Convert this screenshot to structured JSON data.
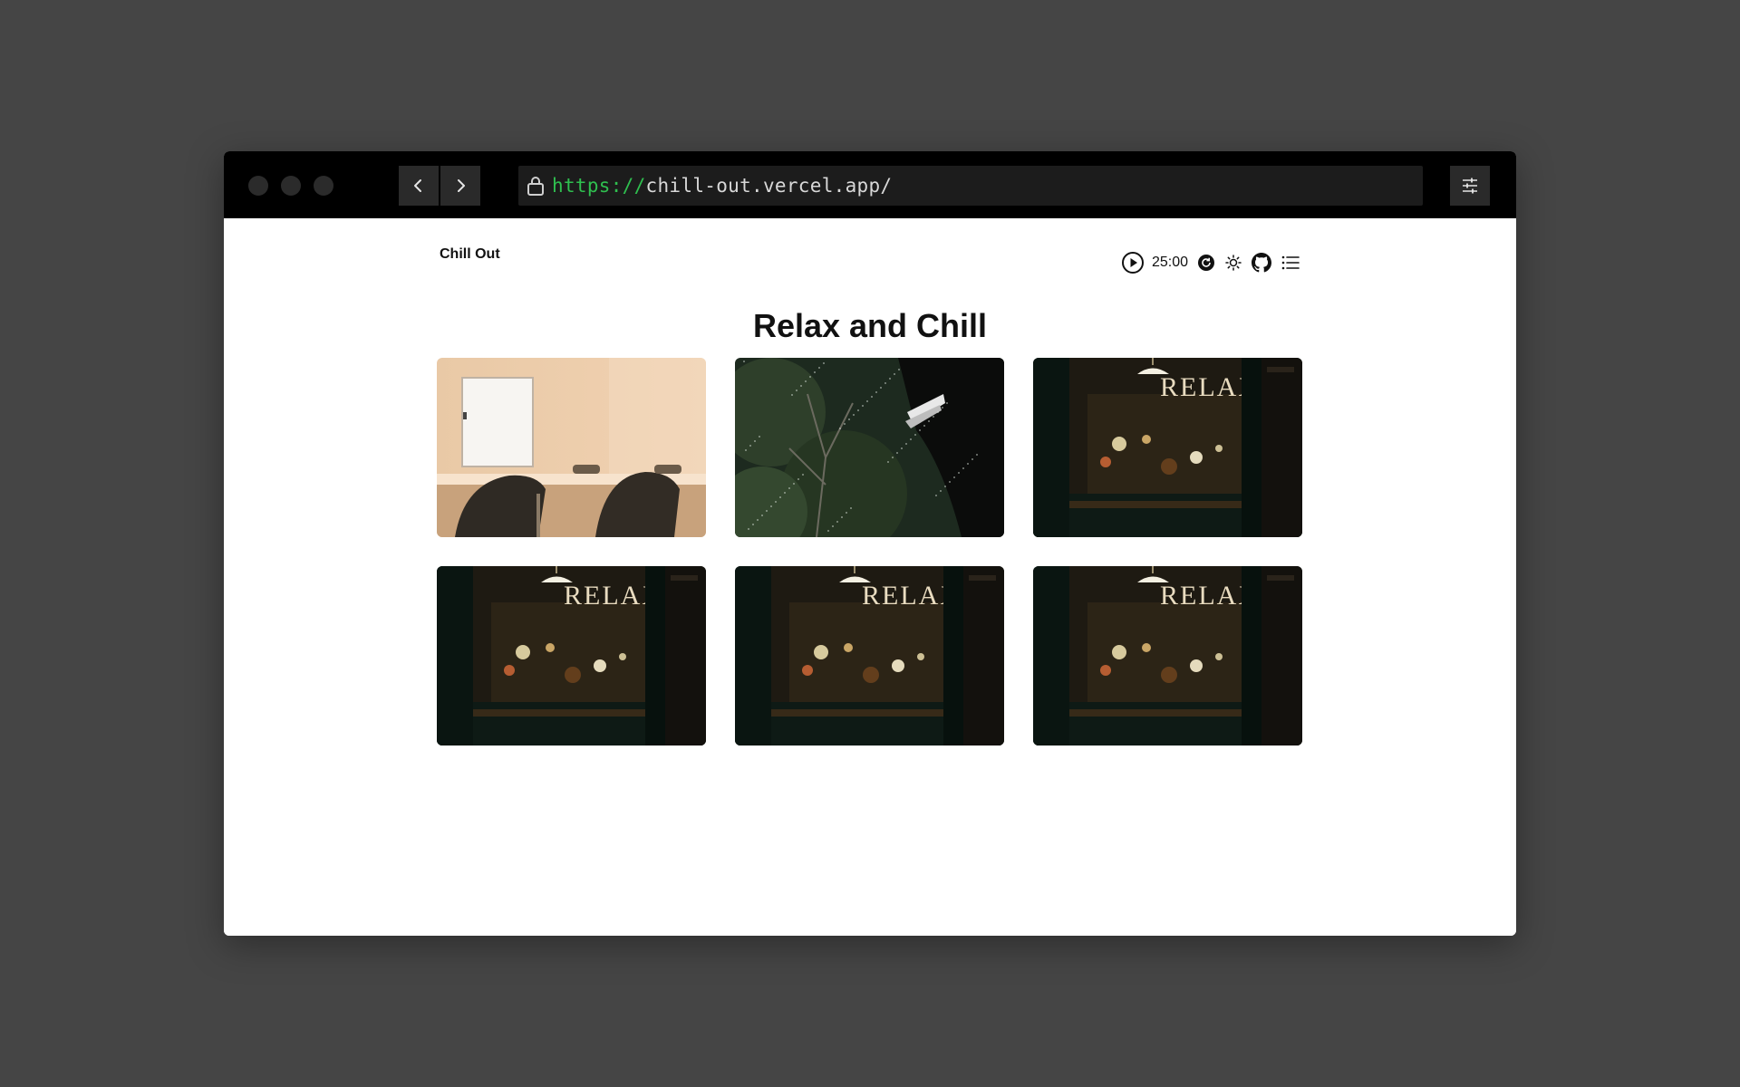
{
  "browser": {
    "url_scheme": "https://",
    "url_host": "chill-out.vercel.app/"
  },
  "header": {
    "brand": "Chill Out",
    "timer": "25:00"
  },
  "main": {
    "title": "Relax and Chill",
    "scenes": [
      {
        "id": "scene-1",
        "kind": "meeting-room",
        "sign": ""
      },
      {
        "id": "scene-2",
        "kind": "rainy-tree",
        "sign": ""
      },
      {
        "id": "scene-3",
        "kind": "cafe-window",
        "sign": "RELAX"
      },
      {
        "id": "scene-4",
        "kind": "cafe-window",
        "sign": "RELAX"
      },
      {
        "id": "scene-5",
        "kind": "cafe-window",
        "sign": "RELAX"
      },
      {
        "id": "scene-6",
        "kind": "cafe-window",
        "sign": "RELAX"
      }
    ]
  },
  "colors": {
    "backdrop": "#454545",
    "chrome": "#000000",
    "url_scheme": "#2fbf4f",
    "url_host": "#d8d8d8"
  }
}
